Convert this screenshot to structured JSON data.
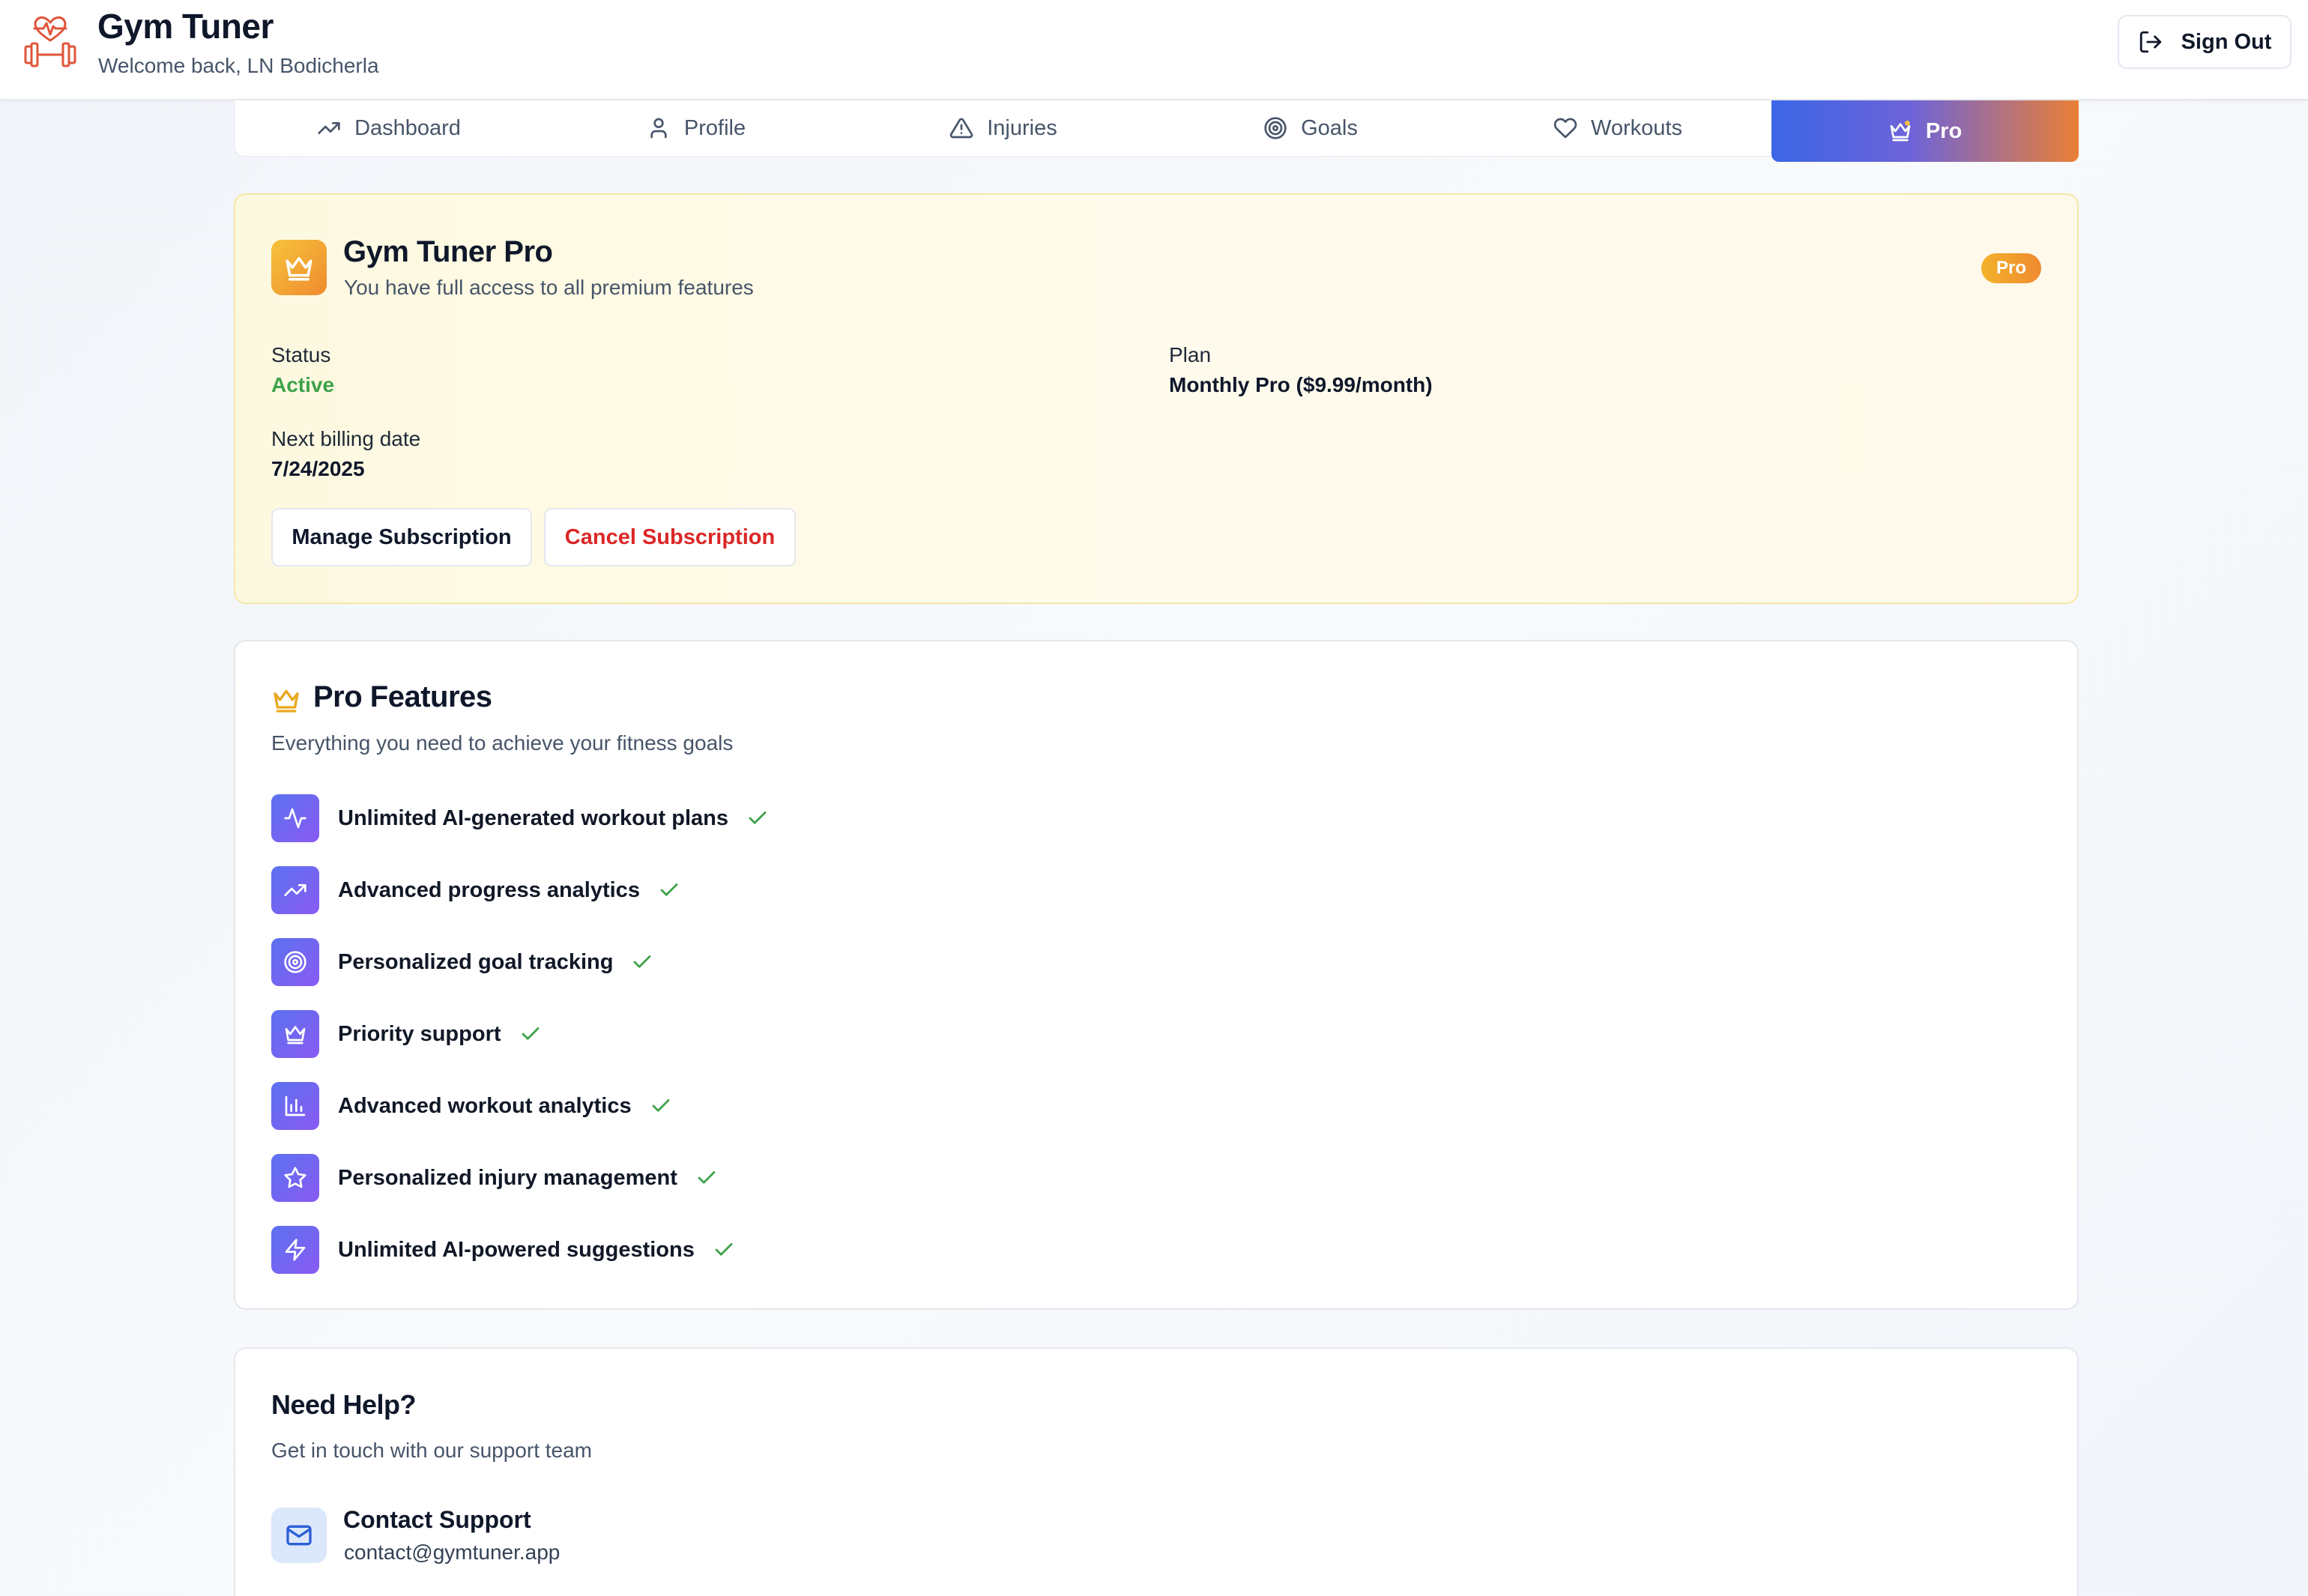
{
  "header": {
    "app_title": "Gym Tuner",
    "welcome": "Welcome back, LN Bodicherla",
    "sign_out_label": "Sign Out"
  },
  "tabs": [
    {
      "label": "Dashboard",
      "icon": "trending-up-icon"
    },
    {
      "label": "Profile",
      "icon": "user-icon"
    },
    {
      "label": "Injuries",
      "icon": "warning-triangle-icon"
    },
    {
      "label": "Goals",
      "icon": "target-icon"
    },
    {
      "label": "Workouts",
      "icon": "heart-icon"
    },
    {
      "label": "Pro",
      "icon": "crown-icon",
      "active": true
    }
  ],
  "subscription": {
    "title": "Gym Tuner Pro",
    "subtitle": "You have full access to all premium features",
    "badge": "Pro",
    "status_label": "Status",
    "status_value": "Active",
    "plan_label": "Plan",
    "plan_value": "Monthly Pro ($9.99/month)",
    "billing_label": "Next billing date",
    "billing_value": "7/24/2025",
    "manage_label": "Manage Subscription",
    "cancel_label": "Cancel Subscription"
  },
  "features": {
    "title": "Pro Features",
    "subtitle": "Everything you need to achieve your fitness goals",
    "items": [
      {
        "label": "Unlimited AI-generated workout plans",
        "icon": "activity-icon"
      },
      {
        "label": "Advanced progress analytics",
        "icon": "trending-up-icon"
      },
      {
        "label": "Personalized goal tracking",
        "icon": "target-icon"
      },
      {
        "label": "Priority support",
        "icon": "crown-icon"
      },
      {
        "label": "Advanced workout analytics",
        "icon": "bar-chart-icon"
      },
      {
        "label": "Personalized injury management",
        "icon": "star-icon"
      },
      {
        "label": "Unlimited AI-powered suggestions",
        "icon": "zap-icon"
      }
    ]
  },
  "help": {
    "title": "Need Help?",
    "subtitle": "Get in touch with our support team",
    "contact_title": "Contact Support",
    "contact_email": "contact@gymtuner.app"
  },
  "colors": {
    "accent_blue": "#3b66e6",
    "accent_orange": "#ea7f35",
    "success": "#3da24a",
    "danger": "#dc2626",
    "feature_tile": "#6b66f1"
  }
}
